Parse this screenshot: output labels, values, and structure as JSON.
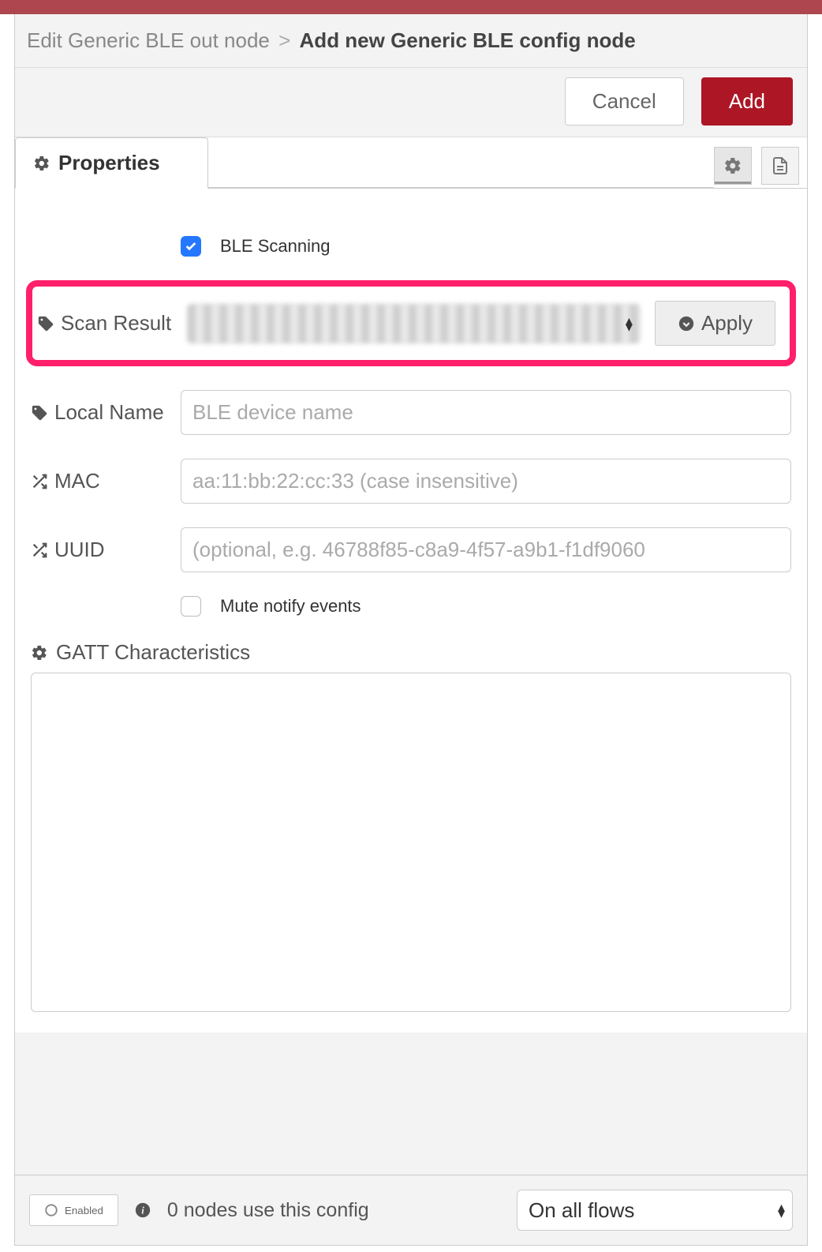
{
  "breadcrumb": {
    "prev": "Edit Generic BLE out node",
    "separator": ">",
    "current": "Add new Generic BLE config node"
  },
  "actions": {
    "cancel": "Cancel",
    "add": "Add"
  },
  "tab": {
    "label": "Properties"
  },
  "form": {
    "ble_scanning_label": "BLE Scanning",
    "ble_scanning_checked": true,
    "scan_result_label": "Scan Result",
    "apply_label": "Apply",
    "local_name_label": "Local Name",
    "local_name_placeholder": "BLE device name",
    "local_name_value": "",
    "mac_label": "MAC",
    "mac_placeholder": "aa:11:bb:22:cc:33 (case insensitive)",
    "mac_value": "",
    "uuid_label": "UUID",
    "uuid_placeholder": "(optional, e.g. 46788f85-c8a9-4f57-a9b1-f1df9060",
    "uuid_value": "",
    "mute_label": "Mute notify events",
    "mute_checked": false,
    "gatt_label": "GATT Characteristics",
    "gatt_value": ""
  },
  "footer": {
    "enabled_label": "Enabled",
    "usage_text": "0 nodes use this config",
    "scope_selected": "On all flows"
  }
}
